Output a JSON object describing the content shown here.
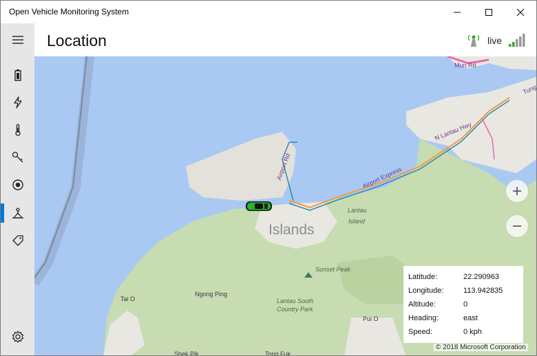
{
  "window": {
    "title": "Open Vehicle Monitoring System"
  },
  "header": {
    "title": "Location",
    "status_label": "live"
  },
  "sidebar": {
    "items": [
      {
        "icon": "hamburger-menu-icon"
      },
      {
        "icon": "battery-icon"
      },
      {
        "icon": "lightning-icon"
      },
      {
        "icon": "thermometer-icon"
      },
      {
        "icon": "key-icon"
      },
      {
        "icon": "record-icon"
      },
      {
        "icon": "location-icon",
        "active": true
      },
      {
        "icon": "tag-icon"
      },
      {
        "icon": "gear-icon"
      }
    ]
  },
  "map": {
    "labels": {
      "islands": "Islands",
      "lantau_island": "Lantau Island",
      "lantau_line1": "Lantau",
      "lantau_line2": "Island",
      "sunset_peak": "Sunset Peak",
      "ngong_ping": "Ngong Ping",
      "lantau_south_line1": "Lantau South",
      "lantau_south_line2": "Country Park",
      "tai_o": "Tai O",
      "pui_o": "Pui O",
      "shek_pik": "Shek Pik",
      "tong_fuk": "Tong Fuk",
      "airport_rd": "Airport Rd",
      "airport_express": "Airport Express",
      "n_lantau_hwy": "N Lantau Hwy",
      "mun_rd": "Mun Rd",
      "tung_c": "Tung C"
    },
    "copyright": "© 2018 Microsoft Corporation",
    "zoom_in_icon": "plus-icon",
    "zoom_out_icon": "minus-icon"
  },
  "info": {
    "latitude_label": "Latitude:",
    "latitude_value": "22.290963",
    "longitude_label": "Longitude:",
    "longitude_value": "113.942835",
    "altitude_label": "Altitude:",
    "altitude_value": "0",
    "heading_label": "Heading:",
    "heading_value": "east",
    "speed_label": "Speed:",
    "speed_value": "0 kph"
  },
  "colors": {
    "sidebar_bg": "#e6e6e6",
    "accent": "#0078d7",
    "water": "#a9c9f3",
    "land_green": "#c7dcb1",
    "land_light": "#e9e7e1"
  }
}
